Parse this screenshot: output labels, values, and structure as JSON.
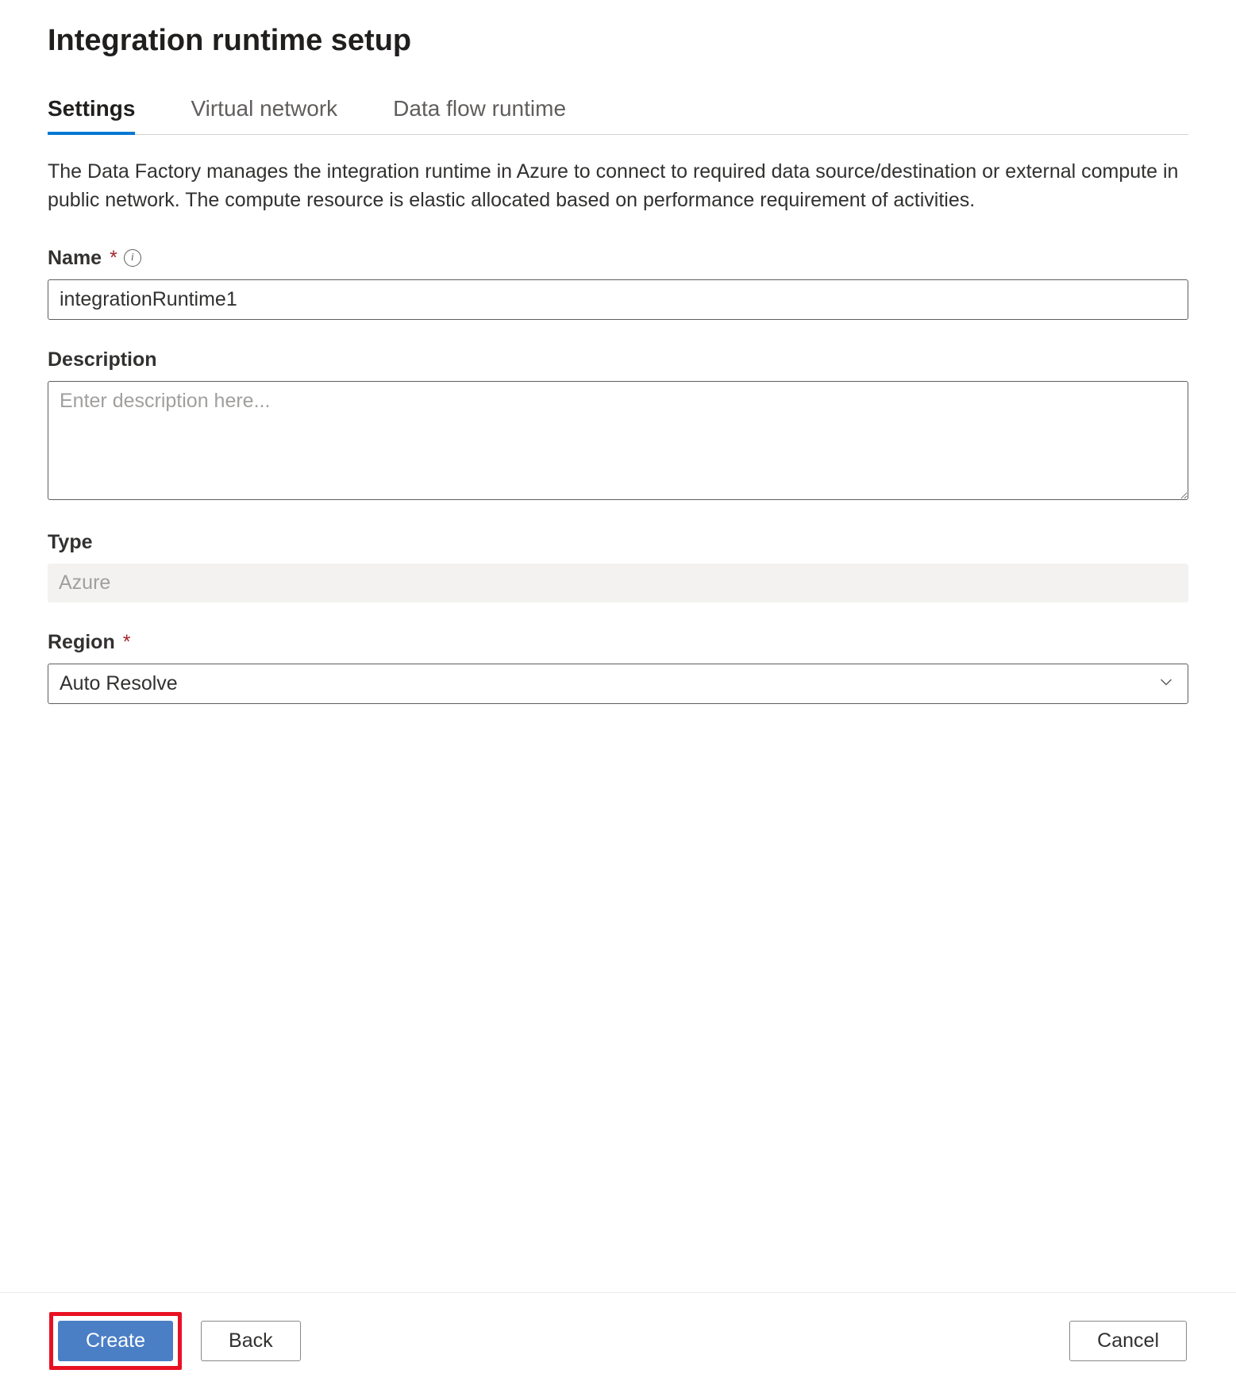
{
  "header": {
    "title": "Integration runtime setup"
  },
  "tabs": [
    {
      "label": "Settings",
      "active": true
    },
    {
      "label": "Virtual network",
      "active": false
    },
    {
      "label": "Data flow runtime",
      "active": false
    }
  ],
  "intro": "The Data Factory manages the integration runtime in Azure to connect to required data source/destination or external compute in public network. The compute resource is elastic allocated based on performance requirement of activities.",
  "fields": {
    "name": {
      "label": "Name",
      "required": true,
      "hasInfo": true,
      "value": "integrationRuntime1"
    },
    "description": {
      "label": "Description",
      "placeholder": "Enter description here...",
      "value": ""
    },
    "type": {
      "label": "Type",
      "value": "Azure"
    },
    "region": {
      "label": "Region",
      "required": true,
      "value": "Auto Resolve"
    }
  },
  "footer": {
    "create": "Create",
    "back": "Back",
    "cancel": "Cancel"
  }
}
